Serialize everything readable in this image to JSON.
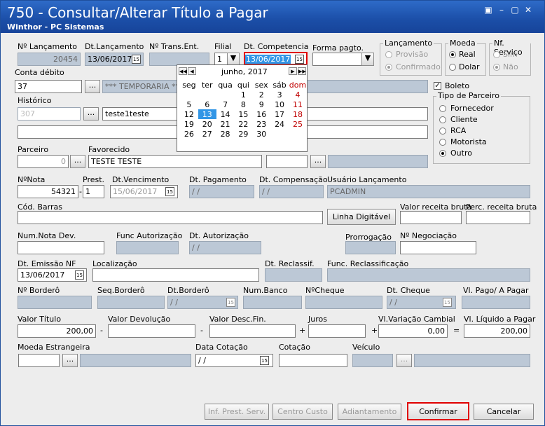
{
  "window": {
    "title": "750 - Consultar/Alterar Título a Pagar",
    "subtitle": "Winthor - PC Sistemas"
  },
  "labels": {
    "nr_lancamento": "Nº Lançamento",
    "dt_lancamento": "Dt.Lançamento",
    "nr_trans_ent": "Nº Trans.Ent.",
    "filial": "Filial",
    "dt_competencia": "Dt. Competencia",
    "forma_pagto": "Forma pagto.",
    "conta_debito": "Conta débito",
    "historico": "Histórico",
    "parceiro": "Parceiro",
    "favorecido": "Favorecido",
    "nr_nota": "NºNota",
    "prest": "Prest.",
    "dt_vencimento": "Dt.Vencimento",
    "dt_pagamento": "Dt. Pagamento",
    "dt_compensacao": "Dt. Compensação",
    "usuario_lancamento": "Usuário Lançamento",
    "cod_barras": "Cód. Barras",
    "valor_receita_bruta": "Valor receita bruta",
    "perc_receita_bruta": "Perc. receita bruta",
    "num_nota_dev": "Num.Nota Dev.",
    "func_autorizacao": "Func Autorização",
    "dt_autorizacao": "Dt. Autorização",
    "prorrogacao": "Prorrogação",
    "nr_negociacao": "Nº Negociação",
    "dt_emissao_nf": "Dt. Emissão NF",
    "localizacao": "Localização",
    "dt_reclassif": "Dt. Reclassif.",
    "func_reclassificacao": "Func. Reclassificação",
    "nr_bordero": "Nº Borderô",
    "seq_bordero": "Seq.Borderô",
    "dt_bordero": "Dt.Borderô",
    "num_banco": "Num.Banco",
    "nr_cheque": "NºCheque",
    "dt_cheque": "Dt. Cheque",
    "vl_pago": "Vl. Pago/ A Pagar",
    "valor_titulo": "Valor Título",
    "valor_devolucao": "Valor Devolução",
    "valor_desc_fin": "Valor Desc.Fin.",
    "juros": "Juros",
    "vl_variacao_cambial": "Vl.Variação Cambial",
    "vl_liquido": "Vl. Líquido a Pagar",
    "moeda_estrangeira": "Moeda Estrangeira",
    "data_cotacao": "Data Cotação",
    "cotacao": "Cotação",
    "veiculo": "Veículo"
  },
  "values": {
    "nr_lancamento": "20454",
    "dt_lancamento": "13/06/2017",
    "filial": "1",
    "dt_competencia": "13/06/2017",
    "conta_debito": "37",
    "conta_debito_desc": "*** TEMPORARIA ***",
    "historico_cod": "307",
    "historico_text": "teste1teste",
    "parceiro": "0",
    "favorecido": "TESTE TESTE",
    "nr_nota": "54321",
    "prest": "1",
    "dt_vencimento": "15/06/2017",
    "dt_pagamento": "/ /",
    "dt_compensacao": "/ /",
    "usuario_lancamento": "PCADMIN",
    "dt_autorizacao": "/ /",
    "dt_emissao_nf": "13/06/2017",
    "dt_bordero": "/ /",
    "dt_cheque": "/ /",
    "valor_titulo": "200,00",
    "vl_variacao_cambial": "0,00",
    "vl_liquido": "200,00",
    "data_cotacao": "/ /"
  },
  "ops": {
    "minus1": "-",
    "minus2": "-",
    "plus1": "+",
    "plus2": "+",
    "eq": "="
  },
  "lancamento": {
    "title": "Lançamento",
    "provisao": "Provisão",
    "confirmado": "Confirmado"
  },
  "moeda": {
    "title": "Moeda",
    "real": "Real",
    "dolar": "Dolar"
  },
  "nf_servico": {
    "title": "Nf. Serviço",
    "sim": "Sim",
    "nao": "Não"
  },
  "boleto": "Boleto",
  "tipo_parceiro": {
    "title": "Tipo de Parceiro",
    "options": [
      "Fornecedor",
      "Cliente",
      "RCA",
      "Motorista",
      "Outro"
    ]
  },
  "calendar": {
    "month_label": "junho, 2017",
    "weekdays": [
      "seg",
      "ter",
      "qua",
      "qui",
      "sex",
      "sáb",
      "dom"
    ],
    "weeks": [
      [
        "",
        "",
        "",
        "1",
        "2",
        "3",
        "4"
      ],
      [
        "5",
        "6",
        "7",
        "8",
        "9",
        "10",
        "11"
      ],
      [
        "12",
        "13",
        "14",
        "15",
        "16",
        "17",
        "18"
      ],
      [
        "19",
        "20",
        "21",
        "22",
        "23",
        "24",
        "25"
      ],
      [
        "26",
        "27",
        "28",
        "29",
        "30",
        "",
        ""
      ]
    ],
    "selected": "13"
  },
  "buttons": {
    "linha_digitavel": "Linha Digitável",
    "inf_prest_serv": "Inf. Prest. Serv.",
    "centro_custo": "Centro Custo",
    "adiantamento": "Adiantamento",
    "confirmar": "Confirmar",
    "cancelar": "Cancelar",
    "ellipsis": "..."
  },
  "accent": {
    "title_bar": "#1b4ea7",
    "highlight_border": "#e00000",
    "selected_day": "#3296e6",
    "disabled_field": "#bcc8d6"
  }
}
